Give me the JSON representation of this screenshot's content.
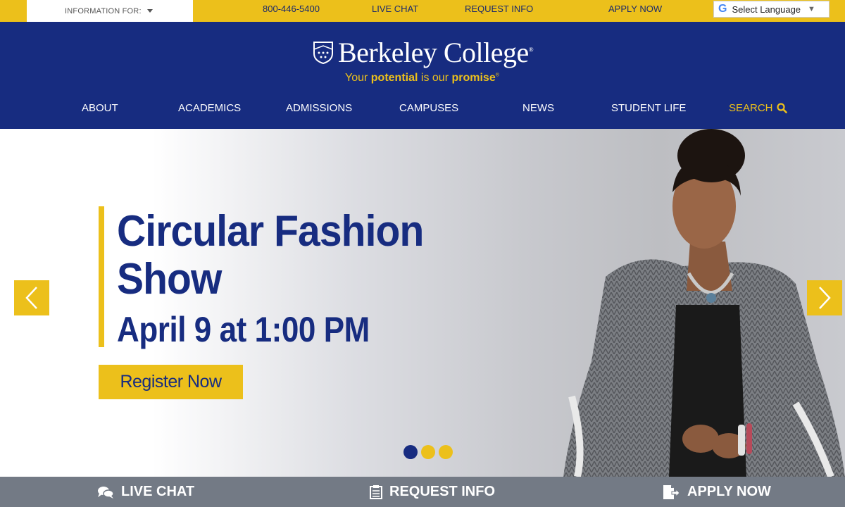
{
  "topbar": {
    "info_for": "INFORMATION FOR:",
    "phone": "800-446-5400",
    "live_chat": "LIVE CHAT",
    "request_info": "REQUEST INFO",
    "apply_now": "APPLY NOW",
    "language": "Select Language",
    "language_arrow": "▼"
  },
  "header": {
    "brand": "Berkeley College",
    "brand_mark": "®",
    "tagline_1": "Your ",
    "tagline_2": "potential",
    "tagline_3": " is our ",
    "tagline_4": "promise",
    "tagline_mark": "®"
  },
  "nav": {
    "items": [
      "ABOUT",
      "ACADEMICS",
      "ADMISSIONS",
      "CAMPUSES",
      "NEWS",
      "STUDENT LIFE"
    ],
    "search": "SEARCH"
  },
  "hero": {
    "title_line1": "Circular Fashion",
    "title_line2": "Show",
    "date": "April 9 at 1:00 PM",
    "cta": "Register Now",
    "slide_count": 3,
    "active_slide": 1
  },
  "bottombar": {
    "live_chat": "LIVE CHAT",
    "request_info": "REQUEST INFO",
    "apply_now": "APPLY NOW"
  },
  "colors": {
    "navy": "#172c80",
    "gold": "#ecc01b",
    "bottom_gray": "#737a85"
  },
  "icons": {
    "search": "search-icon",
    "chat": "chat-icon",
    "form": "form-icon",
    "apply": "apply-icon",
    "prev": "chevron-left-icon",
    "next": "chevron-right-icon"
  }
}
